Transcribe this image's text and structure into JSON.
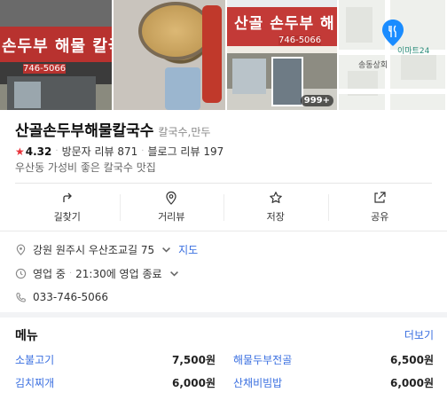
{
  "gallery": {
    "photo_count_badge": "999+",
    "sign_text_1": "손두부 해물 칼국",
    "sign_phone_1": "746-5066",
    "sign_text_3": "산골 손두부 해",
    "sign_phone_3": "746-5066",
    "map_label_poi": "이마트24",
    "map_label_area": "송동상회"
  },
  "place": {
    "name": "산골손두부해물칼국수",
    "category": "칼국수,만두",
    "rating": "4.32",
    "visitor_reviews": "방문자 리뷰 871",
    "blog_reviews": "블로그 리뷰 197",
    "description": "우산동 가성비 좋은 칼국수 맛집"
  },
  "actions": [
    {
      "label": "길찾기",
      "icon": "directions-icon"
    },
    {
      "label": "거리뷰",
      "icon": "street-view-icon"
    },
    {
      "label": "저장",
      "icon": "star-outline-icon"
    },
    {
      "label": "공유",
      "icon": "share-icon"
    }
  ],
  "info": {
    "address": "강원 원주시 우산조교길 75",
    "map_link": "지도",
    "status": "영업 중",
    "hours": "21:30에 영업 종료",
    "phone": "033-746-5066"
  },
  "menu": {
    "title": "메뉴",
    "more_label": "더보기",
    "items": [
      {
        "name": "소불고기",
        "price": "7,500원"
      },
      {
        "name": "해물두부전골",
        "price": "6,500원"
      },
      {
        "name": "김치찌개",
        "price": "6,000원"
      },
      {
        "name": "산채비빔밥",
        "price": "6,000원"
      }
    ]
  },
  "colors": {
    "accent_link": "#3a6fe0",
    "rating_star": "#e8333a",
    "map_pin": "#1a8cff"
  }
}
